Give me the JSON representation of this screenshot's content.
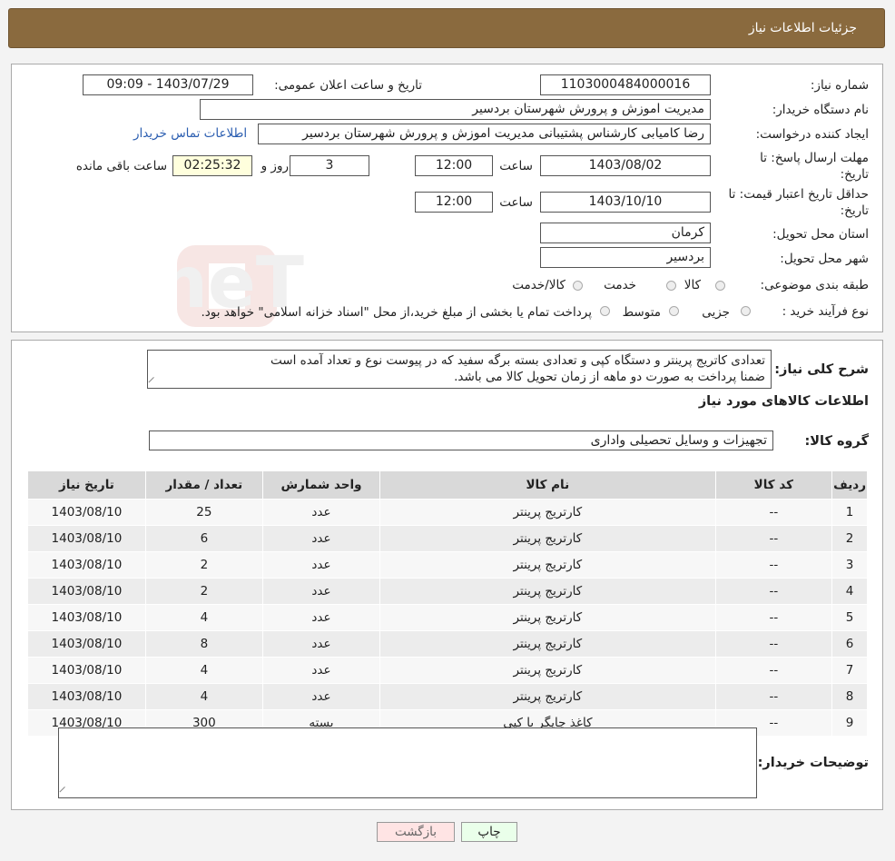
{
  "header": {
    "title": "جزئیات اطلاعات نیاز"
  },
  "form": {
    "need_number_label": "شماره نیاز:",
    "need_number": "1103000484000016",
    "announce_label": "تاریخ و ساعت اعلان عمومی:",
    "announce_value": "1403/07/29 - 09:09",
    "buyer_org_label": "نام دستگاه خریدار:",
    "buyer_org": "مدیریت اموزش و پرورش شهرستان بردسیر",
    "requester_label": "ایجاد کننده درخواست:",
    "requester": "رضا کامیابی کارشناس پشتیبانی مدیریت اموزش و پرورش شهرستان بردسیر",
    "contact_link": "اطلاعات تماس خریدار",
    "deadline_label_1": "مهلت ارسال پاسخ: تا",
    "deadline_label_2": "تاریخ:",
    "deadline_date": "1403/08/02",
    "time_label": "ساعت",
    "deadline_time": "12:00",
    "days_value": "3",
    "days_label": "روز و",
    "remaining_time": "02:25:32",
    "remaining_label": "ساعت باقی مانده",
    "validity_label_1": "حداقل تاریخ اعتبار قیمت: تا",
    "validity_label_2": "تاریخ:",
    "validity_date": "1403/10/10",
    "validity_time": "12:00",
    "province_label": "استان محل تحویل:",
    "province": "کرمان",
    "city_label": "شهر محل تحویل:",
    "city": "بردسیر",
    "category_label": "طبقه بندی موضوعی:",
    "category_options": [
      "کالا",
      "خدمت",
      "کالا/خدمت"
    ],
    "process_label": "نوع فرآیند خرید :",
    "process_options": [
      "جزیی",
      "متوسط"
    ],
    "process_note": "پرداخت تمام یا بخشی از مبلغ خرید،از محل \"اسناد خزانه اسلامی\" خواهد بود."
  },
  "details": {
    "summary_label": "شرح کلی نیاز:",
    "summary_line1": "تعدادی کاتریج پرینتر و دستگاه کپی و تعدادی بسته برگه سفید که در پیوست نوع و تعداد آمده است",
    "summary_line2": "ضمنا پرداخت به صورت دو ماهه از زمان تحویل کالا می باشد.",
    "goods_info_title": "اطلاعات کالاهای مورد نیاز",
    "goods_group_label": "گروه کالا:",
    "goods_group": "تجهیزات و وسایل تحصیلی واداری",
    "table": {
      "headers": [
        "ردیف",
        "کد کالا",
        "نام کالا",
        "واحد شمارش",
        "تعداد / مقدار",
        "تاریخ نیاز"
      ],
      "rows": [
        [
          "1",
          "--",
          "کارتریج پرینتر",
          "عدد",
          "25",
          "1403/08/10"
        ],
        [
          "2",
          "--",
          "کارتریج پرینتر",
          "عدد",
          "6",
          "1403/08/10"
        ],
        [
          "3",
          "--",
          "کارتریج پرینتر",
          "عدد",
          "2",
          "1403/08/10"
        ],
        [
          "4",
          "--",
          "کارتریج پرینتر",
          "عدد",
          "2",
          "1403/08/10"
        ],
        [
          "5",
          "--",
          "کارتریج پرینتر",
          "عدد",
          "4",
          "1403/08/10"
        ],
        [
          "6",
          "--",
          "کارتریج پرینتر",
          "عدد",
          "8",
          "1403/08/10"
        ],
        [
          "7",
          "--",
          "کارتریج پرینتر",
          "عدد",
          "4",
          "1403/08/10"
        ],
        [
          "8",
          "--",
          "کارتریج پرینتر",
          "عدد",
          "4",
          "1403/08/10"
        ],
        [
          "9",
          "--",
          "کاغذ چاپگر یا کپی",
          "بسته",
          "300",
          "1403/08/10"
        ]
      ]
    },
    "buyer_notes_label": "توضیحات خریدار:",
    "buyer_notes": ""
  },
  "buttons": {
    "print": "چاپ",
    "back": "بازگشت"
  },
  "colors": {
    "header_bg": "#8a6a3e",
    "link": "#2a5db0",
    "print_btn_bg": "#eaffea",
    "back_btn_bg": "#ffe4e4"
  },
  "watermark": {
    "text": "AriaTender.neT"
  }
}
